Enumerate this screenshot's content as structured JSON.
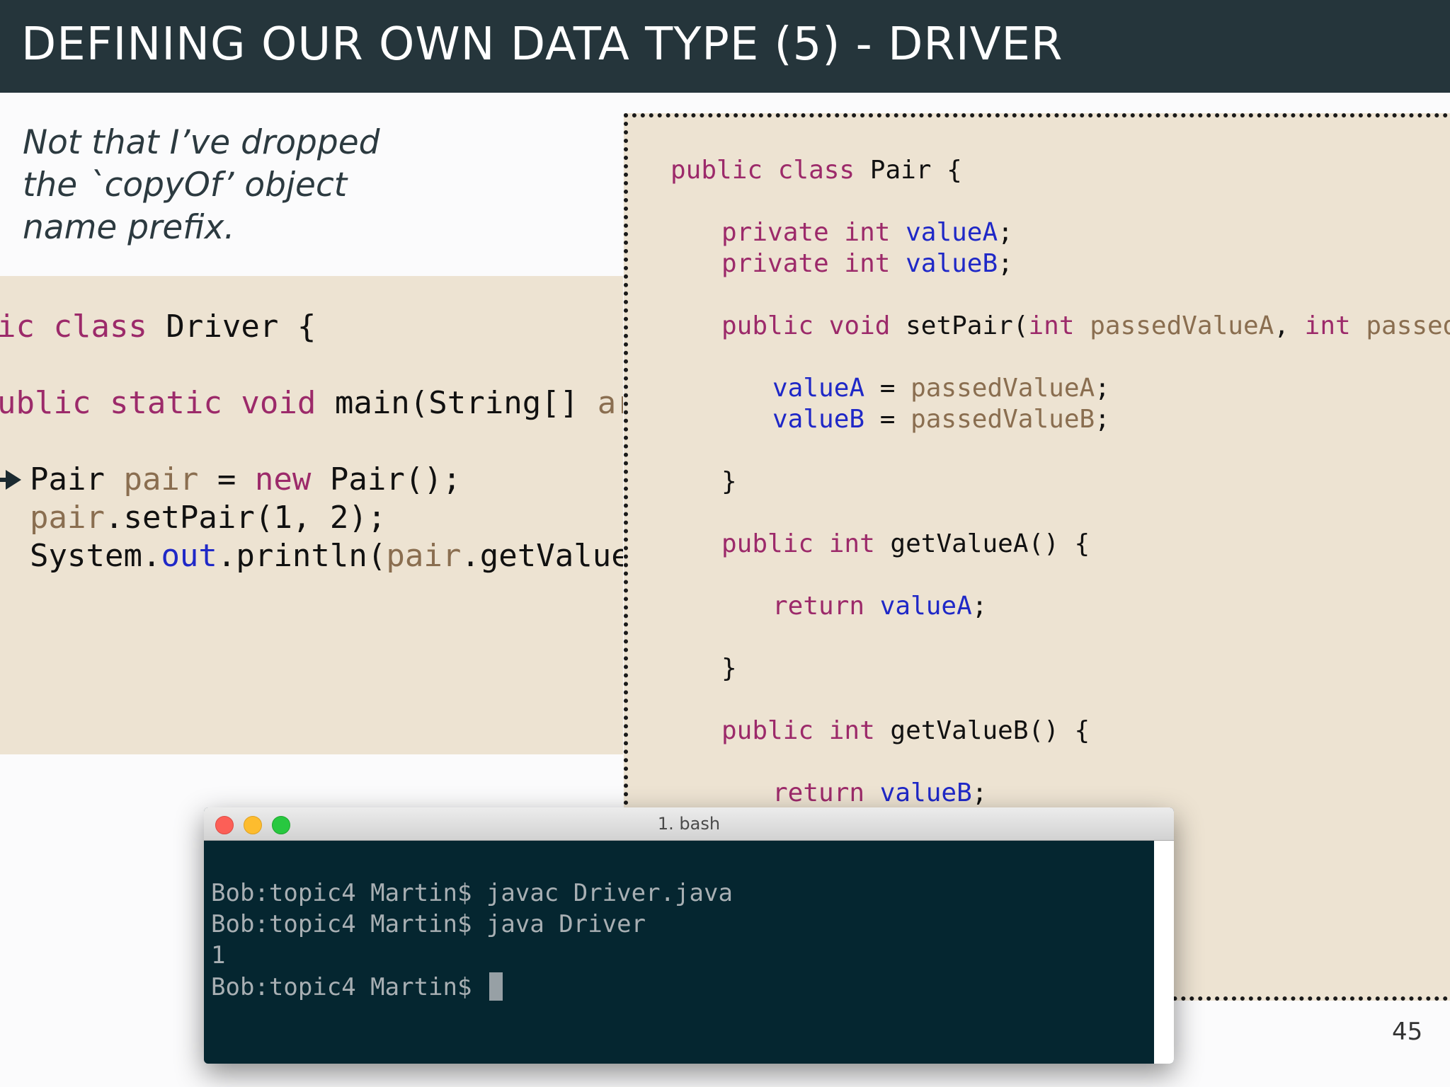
{
  "slide": {
    "title": "DEFINING OUR OWN DATA TYPE (5) - DRIVER",
    "note_lines": [
      "Not that I’ve dropped",
      "the `copyOf’ object",
      "name prefix."
    ],
    "page_number": "45"
  },
  "driver_code": {
    "l1": {
      "a": "ic class",
      "b": " Driver {"
    },
    "l2": {
      "a": "ublic static void",
      "b": " main(String[] ",
      "c": "args",
      "d": ")"
    },
    "l3": {
      "a": "Pair ",
      "b": "pair",
      "c": " = ",
      "d": "new",
      "e": " Pair();"
    },
    "l4": {
      "a": "pair",
      "b": ".setPair(1, 2);"
    },
    "l5": {
      "a": "System.",
      "b": "out",
      "c": ".println(",
      "d": "pair",
      "e": ".getValueA()"
    }
  },
  "pair_code": {
    "l1": {
      "a": "public class",
      "b": " Pair {"
    },
    "l2": {
      "a": "private int",
      "b": "valueA",
      "c": ";"
    },
    "l3": {
      "a": "private int",
      "b": "valueB",
      "c": ";"
    },
    "l4": {
      "a": "public void",
      "b": " setPair(",
      "c": "int",
      "d": " passedValueA",
      "e": ", ",
      "f": "int",
      "g": " passedVal"
    },
    "l5": {
      "a": "valueA",
      "b": " = ",
      "c": "passedValueA",
      "d": ";"
    },
    "l6": {
      "a": "valueB",
      "b": " = ",
      "c": "passedValueB",
      "d": ";"
    },
    "l7": {
      "a": "}"
    },
    "l8": {
      "a": "public int",
      "b": " getValueA() {"
    },
    "l9": {
      "a": "return",
      "b": "valueA",
      "c": ";"
    },
    "l10": {
      "a": "}"
    },
    "l11": {
      "a": "public int",
      "b": " getValueB() {"
    },
    "l12": {
      "a": "return",
      "b": "valueB",
      "c": ";"
    }
  },
  "terminal": {
    "title": "1. bash",
    "lines": [
      "Bob:topic4 Martin$ javac Driver.java",
      "Bob:topic4 Martin$ java Driver",
      "1",
      "Bob:topic4 Martin$ "
    ]
  },
  "icons": {
    "execution_marker": "arrow-right-icon",
    "window_controls": [
      "close-icon",
      "minimize-icon",
      "zoom-icon"
    ]
  },
  "colors": {
    "title_bar": "#25353b",
    "code_background": "#ede3d2",
    "keyword": "#9c2a6a",
    "variable": "#8a6e50",
    "field": "#1f28c7",
    "terminal_background": "#052630"
  }
}
